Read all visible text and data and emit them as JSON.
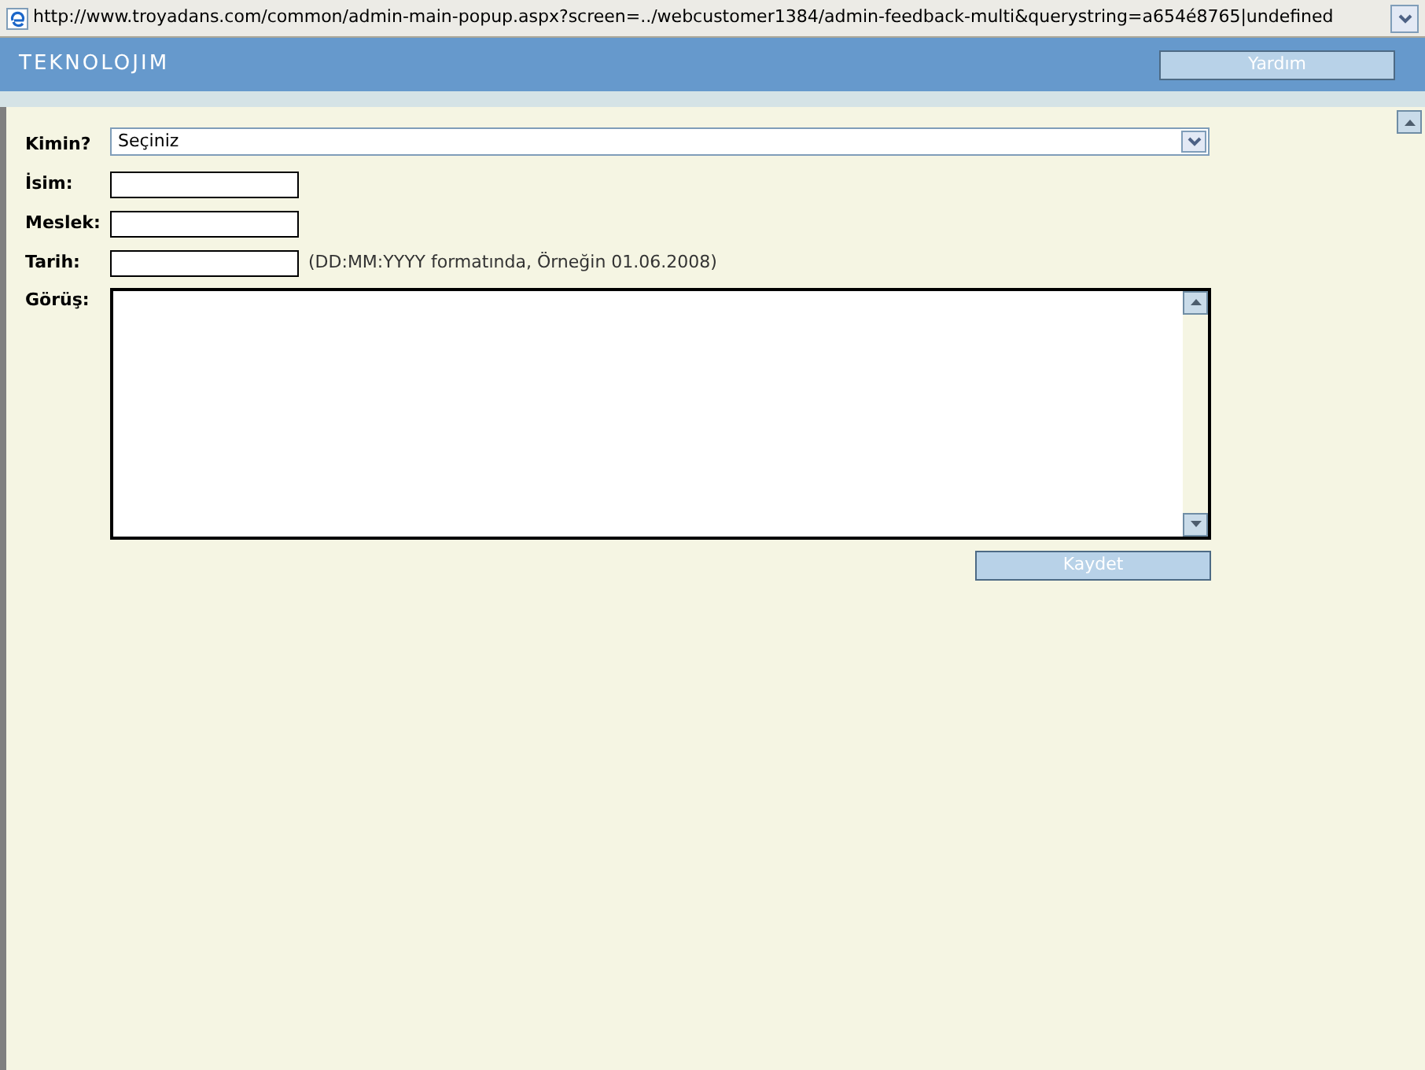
{
  "address_bar": {
    "url": "http://www.troyadans.com/common/admin-main-popup.aspx?screen=../webcustomer1384/admin-feedback-multi&querystring=a654é8765|undefined"
  },
  "header": {
    "logo": "TEKNOLOJIM",
    "help_button": "Yardım"
  },
  "form": {
    "fields": [
      {
        "kind": "select",
        "label": "Kimin?",
        "value": "Seçiniz"
      },
      {
        "kind": "text",
        "label": "İsim:"
      },
      {
        "kind": "text",
        "label": "Meslek:"
      },
      {
        "kind": "text",
        "label": "Tarih:",
        "hint": "(DD:MM:YYYY formatında, Örneğin 01.06.2008)"
      },
      {
        "kind": "textarea",
        "label": "Görüş:"
      }
    ],
    "save_button": "Kaydet"
  }
}
